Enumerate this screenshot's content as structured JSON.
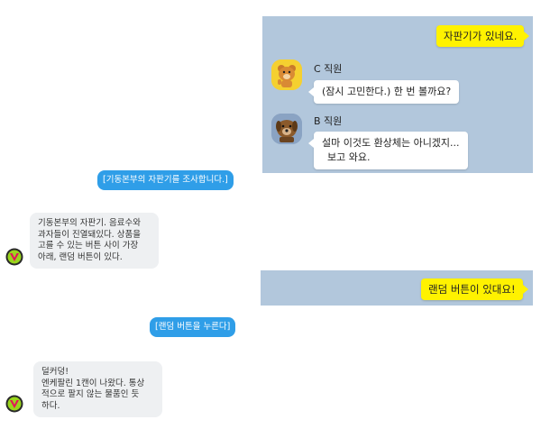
{
  "top_panel": {
    "outgoing_1": "자판기가 있네요.",
    "c_staff": {
      "name": "C 직원",
      "message": "(잠시 고민한다.) 한 번 볼까요?"
    },
    "b_staff": {
      "name": "B 직원",
      "message_line1": "설마 이것도 환상체는 아니겠지...",
      "message_line2": "보고 와요."
    }
  },
  "bottom_panel": {
    "outgoing_2": "랜덤 버튼이 있대요!"
  },
  "left_chat": {
    "action_1": "[기동본부의 자판기를 조사합니다.]",
    "reply_1": "기동본부의 자판기. 음료수와\n과자들이 진열돼있다. 상품을\n고를 수 있는 버튼 사이 가장\n아래, 랜덤 버튼이 있다.",
    "action_2": "[랜덤 버튼을 누른다]",
    "reply_2": "덜커덩!\n엔케팔린 1캔이 나왔다. 통상\n적으로 팔지 않는 물품인 듯\n하다."
  },
  "colors": {
    "panel": "#b2c7dc",
    "yellow": "#fff200",
    "blue": "#2f9ee8",
    "gray": "#eef0f2"
  },
  "icons": [
    "bear-avatar-icon",
    "dog-avatar-icon",
    "v-logo-icon"
  ]
}
